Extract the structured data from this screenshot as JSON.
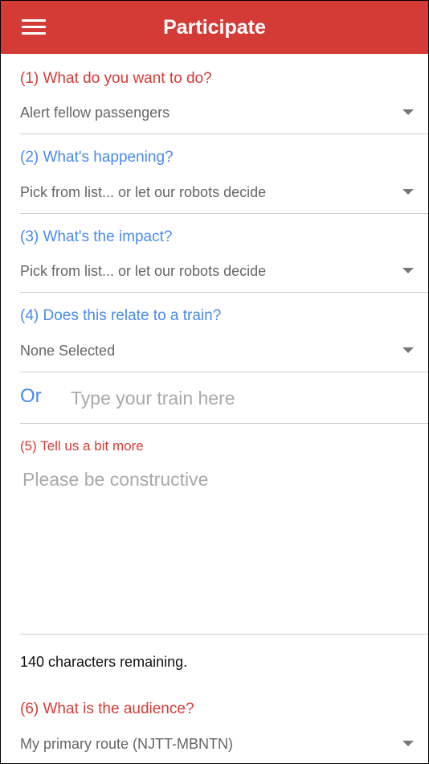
{
  "header": {
    "title": "Participate",
    "menu_icon": "hamburger-menu-icon"
  },
  "questions": [
    {
      "label": "(1) What do you want to do?",
      "value": "Alert fellow passengers",
      "color": "#d53b36"
    },
    {
      "label": "(2) What's happening?",
      "value": "Pick from list... or let our robots decide",
      "color": "#4a8af0"
    },
    {
      "label": "(3) What's the impact?",
      "value": "Pick from list... or let our robots decide",
      "color": "#4a8af0"
    },
    {
      "label": "(4) Does this relate to a train?",
      "value": "None Selected",
      "color": "#4a8af0"
    }
  ],
  "train": {
    "or_label": "Or",
    "placeholder": "Type your train here",
    "value": ""
  },
  "more": {
    "label": "(5) Tell us a bit more",
    "placeholder": "Please be constructive",
    "value": "",
    "remaining_text": "140 characters remaining."
  },
  "audience": {
    "label": "(6) What is the audience?",
    "value": "My primary route (NJTT-MBNTN)"
  },
  "colors": {
    "brand": "#d53b36",
    "accent": "#4a8af0"
  }
}
